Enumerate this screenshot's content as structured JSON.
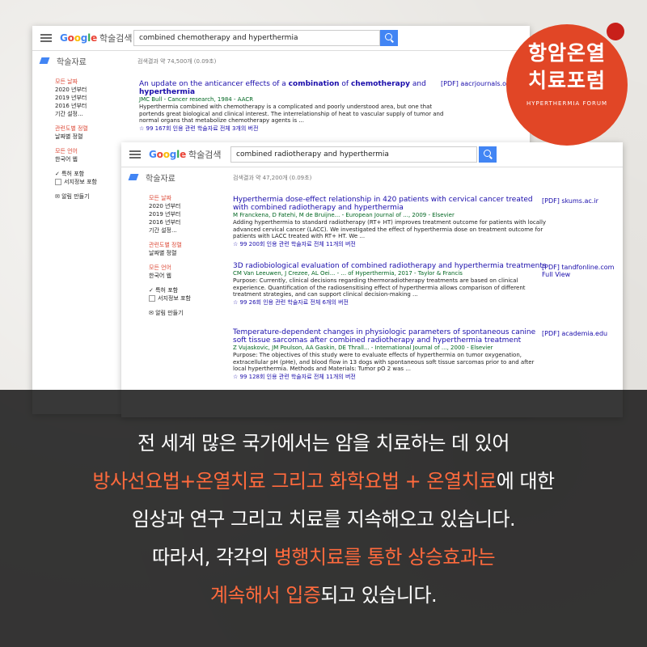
{
  "window1": {
    "logo": "Google",
    "scholar_label": "학술검색",
    "query": "combined chemotherapy and hyperthermia",
    "section": "학술자료",
    "result_count": "검색결과 약 74,500개 (0.09초)",
    "sidebar": [
      "모든 날짜",
      "2020 년부터",
      "2019 년부터",
      "2016 년부터",
      "기간 설정...",
      "",
      "관련도별 정렬",
      "날짜별 정렬",
      "",
      "모든 언어",
      "한국어 웹",
      "",
      "특허 포함",
      "서지정보 포함",
      "",
      "알림 만들기"
    ],
    "results": [
      {
        "title_pre": "An update on the anticancer effects of a ",
        "title_b1": "combination",
        "title_mid": " of ",
        "title_b2": "chemotherapy",
        "title_post": " and",
        "title_line2": "hyperthermia",
        "meta": "JMC Bull - Cancer research, 1984 - AACR",
        "snippet": "Hyperthermia combined with chemotherapy is a complicated and poorly understood area, but one that portends great biological and clinical interest. The interrelationship of heat to vascular supply of tumor and normal organs that metabolize chemotherapy agents is ...",
        "actions": "☆  99  167회 인용   관련 학술자료   전체 3개의 버전",
        "pdf": "[PDF] aacrjournals.org"
      }
    ]
  },
  "window2": {
    "logo": "Google",
    "scholar_label": "학술검색",
    "query": "combined radiotherapy and hyperthermia",
    "section": "학술자료",
    "result_count": "검색결과 약 47,200개 (0.09초)",
    "sidebar": [
      "모든 날짜",
      "2020 년부터",
      "2019 년부터",
      "2016 년부터",
      "기간 설정...",
      "",
      "관련도별 정렬",
      "날짜별 정렬",
      "",
      "모든 언어",
      "한국어 웹",
      "",
      "특허 포함",
      "서지정보 포함",
      "",
      "알림 만들기"
    ],
    "results": [
      {
        "title": "Hyperthermia dose-effect relationship in 420 patients with cervical cancer treated with combined radiotherapy and hyperthermia",
        "meta": "M Franckena, D Fatehi, M de Bruijne... - European Journal of ..., 2009 - Elsevier",
        "snippet": "Adding hyperthermia to standard radiotherapy (RT+ HT) improves treatment outcome for patients with locally advanced cervical cancer (LACC). We investigated the effect of hyperthermia dose on treatment outcome for patients with LACC treated with RT+ HT. We ...",
        "actions": "☆  99  200회 인용   관련 학술자료   전체 11개의 버전",
        "pdf": "[PDF] skums.ac.ir",
        "pdf2": ""
      },
      {
        "title": "3D radiobiological evaluation of combined radiotherapy and hyperthermia treatments",
        "meta": "CM Van Leeuwen, J Crezee, AL Oei... - ... of Hyperthermia, 2017 - Taylor & Francis",
        "snippet": "Purpose: Currently, clinical decisions regarding thermoradiotherapy treatments are based on clinical experience. Quantification of the radiosensitising effect of hyperthermia allows comparison of different treatment strategies, and can support clinical decision-making ...",
        "actions": "☆  99  26회 인용   관련 학술자료   전체 6개의 버전",
        "pdf": "[PDF] tandfonline.com",
        "pdf2": "Full View"
      },
      {
        "title": "Temperature-dependent changes in physiologic parameters of spontaneous canine soft tissue sarcomas after combined radiotherapy and hyperthermia treatment",
        "meta": "Z Vujaskovic, JM Poulson, AA Gaskin, DE Thrall... - International Journal of ..., 2000 - Elsevier",
        "snippet": "Purpose: The objectives of this study were to evaluate effects of hyperthermia on tumor oxygenation, extracellular pH (pHe), and blood flow in 13 dogs with spontaneous soft tissue sarcomas prior to and after local hyperthermia. Methods and Materials: Tumor pO 2 was ...",
        "actions": "☆  99  128회 인용   관련 학술자료   전체 11개의 버전",
        "pdf": "[PDF] academia.edu",
        "pdf2": ""
      }
    ]
  },
  "badge": {
    "line1": "항암온열",
    "line2": "치료포럼",
    "line3": "HYPERTHERMIA FORUM"
  },
  "caption": {
    "line1": "전 세계 많은 국가에서는 암을 치료하는 데 있어",
    "line2_highlight": "방사선요법+온열치료 그리고 화학요법 + 온열치료",
    "line2_rest": "에 대한",
    "line3": "임상과 연구 그리고 치료를 지속해오고 있습니다.",
    "line4_pre": "따라서, 각각의 ",
    "line4_highlight": "병행치료를 통한 상승효과는",
    "line5_highlight": "계속해서 입증",
    "line5_rest": "되고 있습니다."
  },
  "colors": {
    "accent": "#ff6a3d",
    "badge": "#e14626",
    "link": "#1a0dab",
    "meta": "#006621"
  }
}
